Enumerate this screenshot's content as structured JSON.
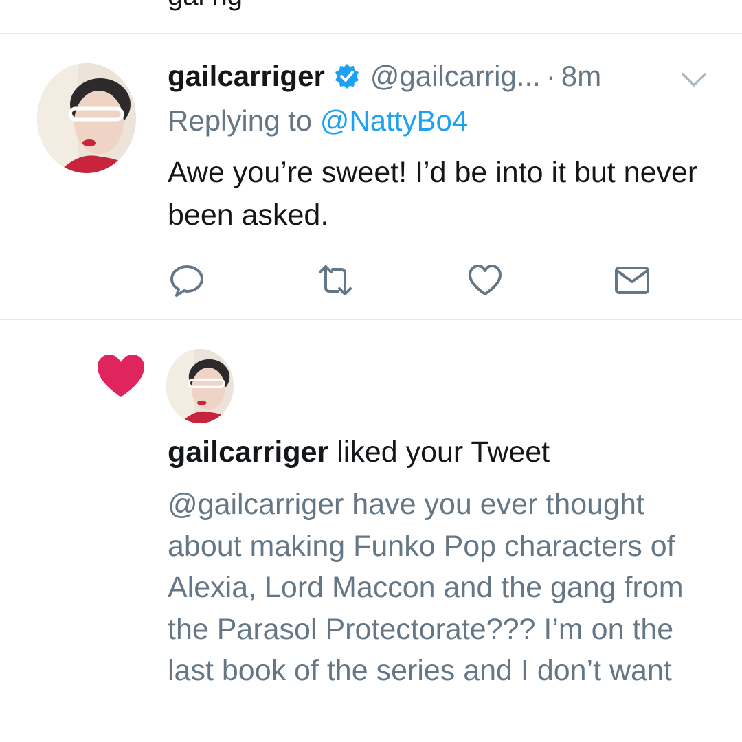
{
  "tweet": {
    "display_name": "gailcarriger",
    "handle": "@gailcarrig...",
    "separator": "·",
    "time": "8m",
    "replying_prefix": "Replying to ",
    "replying_to": "@NattyBo4",
    "text": "Awe you’re sweet! I’d be into it but never been asked.",
    "actions": [
      "reply-icon",
      "retweet-icon",
      "like-icon",
      "direct-message-icon"
    ]
  },
  "notification": {
    "user": "gailcarriger",
    "action_text": " liked your Tweet",
    "liked_tweet_text": "@gailcarriger have you ever thought about making Funko Pop characters of Alexia, Lord Maccon and the gang from the Parasol Protectorate??? I’m on the last book of the series and I don’t want"
  },
  "colors": {
    "link": "#1da1f2",
    "verified_badge": "#1da1f2",
    "like_heart": "#e0245e",
    "secondary_text": "#657786",
    "icon_gray": "#657786",
    "divider": "#e1e8ed"
  }
}
